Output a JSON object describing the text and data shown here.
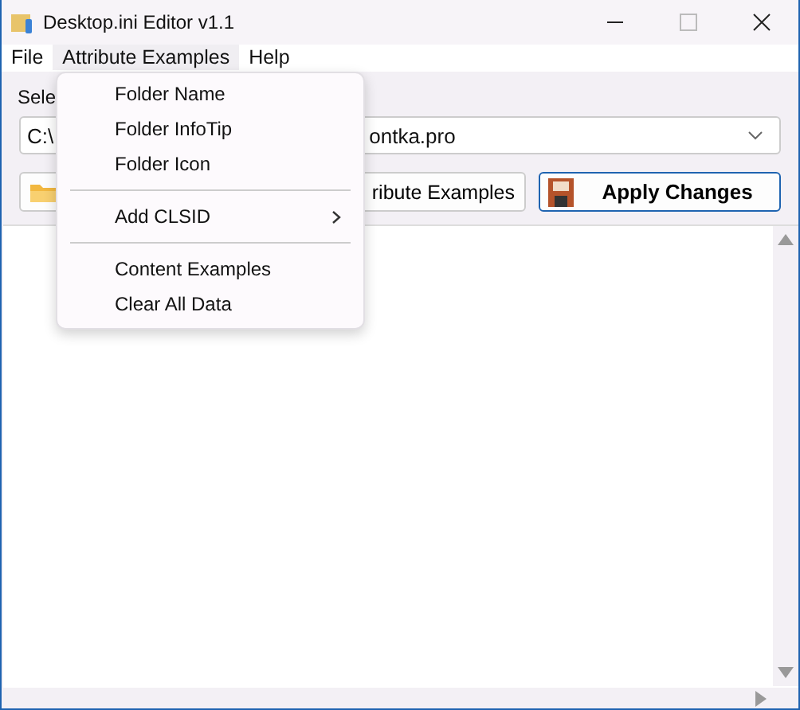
{
  "window": {
    "title": "Desktop.ini Editor v1.1"
  },
  "menu_bar": [
    {
      "label": "File",
      "selected": false
    },
    {
      "label": "Attribute Examples",
      "selected": true
    },
    {
      "label": "Help",
      "selected": false
    }
  ],
  "folder_label": "Sele",
  "folder_combo": {
    "value_start": "C:\\",
    "value_end": "ontka.pro"
  },
  "buttons": [
    {
      "kind": "folder"
    },
    {
      "kind": "text",
      "label": "ribute Examples"
    },
    {
      "kind": "apply",
      "label": "Apply Changes"
    }
  ],
  "dropdown_menu": [
    {
      "kind": "item",
      "label": "Folder Name"
    },
    {
      "kind": "item",
      "label": "Folder InfoTip"
    },
    {
      "kind": "item",
      "label": "Folder Icon"
    },
    {
      "kind": "separator"
    },
    {
      "kind": "submenu",
      "label": "Add CLSID"
    },
    {
      "kind": "separator"
    },
    {
      "kind": "item",
      "label": "Content Examples"
    },
    {
      "kind": "item",
      "label": "Clear All Data"
    }
  ]
}
